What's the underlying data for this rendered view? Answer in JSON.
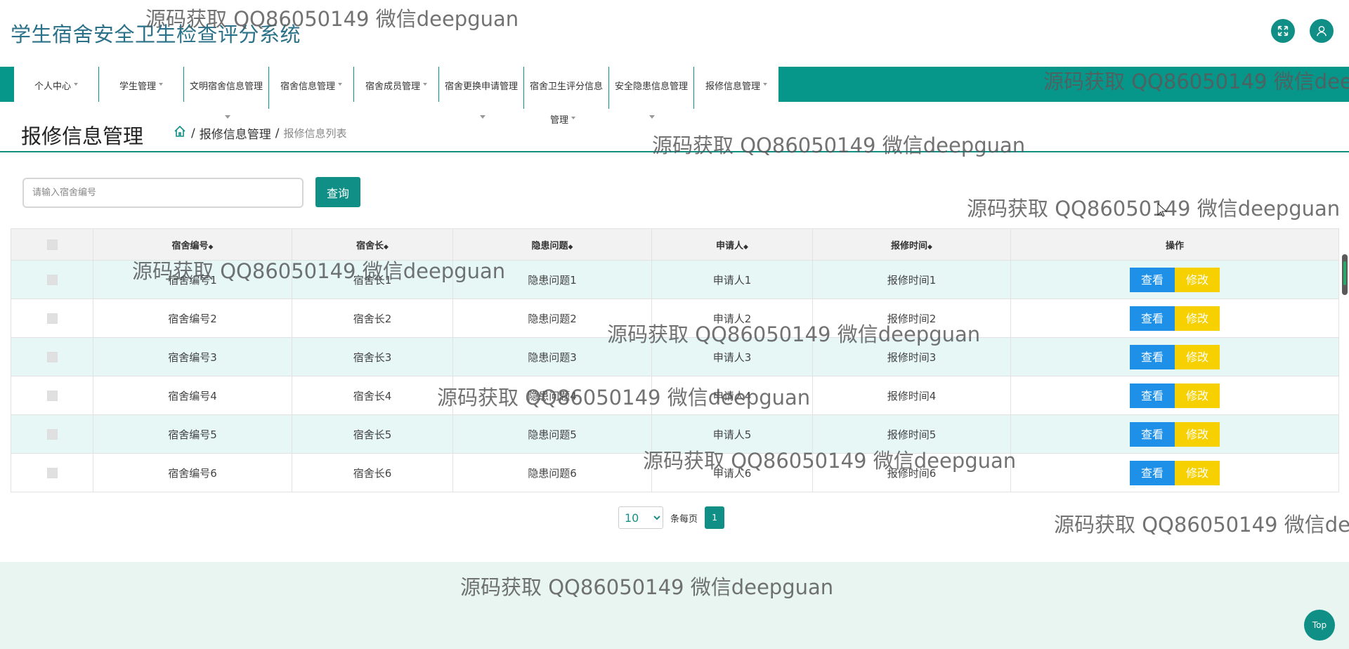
{
  "header": {
    "title": "学生宿舍安全卫生检查评分系统",
    "fullscreen_icon": "expand-icon",
    "user_icon": "user-icon"
  },
  "nav": {
    "items": [
      {
        "label": "个人中心"
      },
      {
        "label": "学生管理"
      },
      {
        "label": "文明宿舍信息管理"
      },
      {
        "label": "宿舍信息管理"
      },
      {
        "label": "宿舍成员管理"
      },
      {
        "label": "宿舍更换申请管理"
      },
      {
        "label": "宿舍卫生评分信息",
        "sub": "管理"
      },
      {
        "label": "安全隐患信息管理"
      },
      {
        "label": "报修信息管理"
      }
    ]
  },
  "page": {
    "title": "报修信息管理",
    "breadcrumb_section": "报修信息管理",
    "breadcrumb_current": "报修信息列表"
  },
  "search": {
    "placeholder": "请输入宿舍编号",
    "button_label": "查询"
  },
  "table": {
    "columns": [
      "宿舍编号",
      "宿舍长",
      "隐患问题",
      "申请人",
      "报修时间",
      "操作"
    ],
    "sort_glyph": "◆",
    "rows": [
      {
        "no": "宿舍编号1",
        "leader": "宿舍长1",
        "issue": "隐患问题1",
        "applicant": "申请人1",
        "time": "报修时间1"
      },
      {
        "no": "宿舍编号2",
        "leader": "宿舍长2",
        "issue": "隐患问题2",
        "applicant": "申请人2",
        "time": "报修时间2"
      },
      {
        "no": "宿舍编号3",
        "leader": "宿舍长3",
        "issue": "隐患问题3",
        "applicant": "申请人3",
        "time": "报修时间3"
      },
      {
        "no": "宿舍编号4",
        "leader": "宿舍长4",
        "issue": "隐患问题4",
        "applicant": "申请人4",
        "time": "报修时间4"
      },
      {
        "no": "宿舍编号5",
        "leader": "宿舍长5",
        "issue": "隐患问题5",
        "applicant": "申请人5",
        "time": "报修时间5"
      },
      {
        "no": "宿舍编号6",
        "leader": "宿舍长6",
        "issue": "隐患问题6",
        "applicant": "申请人6",
        "time": "报修时间6"
      }
    ],
    "view_label": "查看",
    "edit_label": "修改"
  },
  "pager": {
    "page_size": "10",
    "per_page_label": "条每页",
    "current_page": "1"
  },
  "top_button": "Top",
  "watermark": "源码获取 QQ86050149 微信deepguan",
  "colors": {
    "primary": "#0f8f85",
    "nav_bar": "#06968a",
    "title": "#2a7189",
    "view": "#1e90e8",
    "edit": "#f7d000",
    "row_stripe": "#e6f7f6",
    "footer": "#e8f5f0"
  }
}
